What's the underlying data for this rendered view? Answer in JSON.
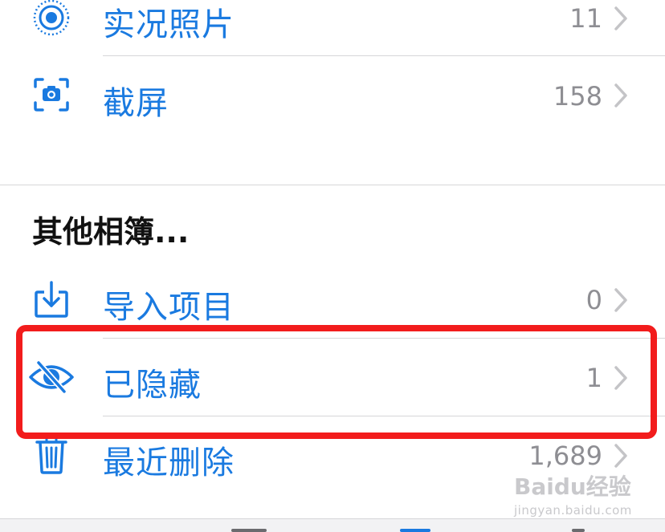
{
  "albums": [
    {
      "label": "实况照片",
      "count": "11",
      "icon": "live-photo-icon"
    },
    {
      "label": "截屏",
      "count": "158",
      "icon": "screenshot-icon"
    }
  ],
  "other_section_title": "其他相簿...",
  "other_albums": [
    {
      "label": "导入项目",
      "count": "0",
      "icon": "import-icon"
    },
    {
      "label": "已隐藏",
      "count": "1",
      "icon": "eye-slash-icon"
    },
    {
      "label": "最近删除",
      "count": "1,689",
      "icon": "trash-icon"
    }
  ],
  "watermark": {
    "brand": "Baidu经验",
    "url": "jingyan.baidu.com"
  },
  "colors": {
    "accent": "#1a7ae0",
    "highlight": "#f21c1c",
    "secondary_text": "#8e8e93"
  }
}
